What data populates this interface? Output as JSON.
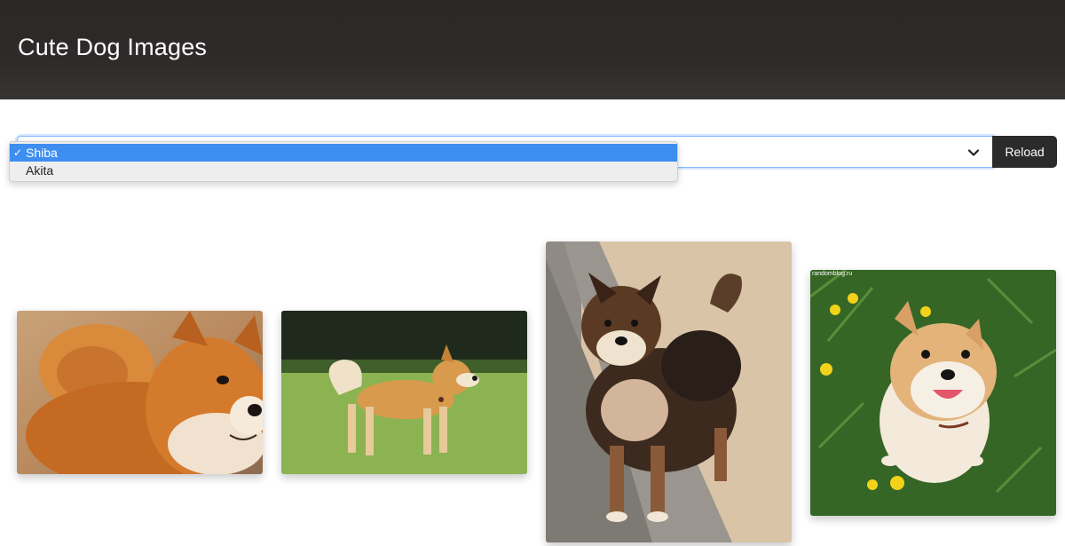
{
  "header": {
    "title": "Cute Dog Images"
  },
  "breed_select": {
    "selected_value": "Shiba",
    "options": [
      {
        "label": "Shiba",
        "selected": true
      },
      {
        "label": "Akita",
        "selected": false
      }
    ],
    "check_mark": "✓"
  },
  "reload_button": {
    "label": "Reload"
  },
  "images": [
    {
      "subject": "shiba-closeup-portrait"
    },
    {
      "subject": "shiba-standing-on-grass"
    },
    {
      "subject": "black-tan-shiba-on-wall"
    },
    {
      "subject": "smiling-shiba-among-dandelions",
      "watermark": "randomblog.ru"
    }
  ],
  "colors": {
    "header_bg": "#2f2a2a",
    "select_focus": "#86b7fe",
    "option_highlight": "#3d8ef0",
    "button_bg": "#2b2b2b"
  }
}
